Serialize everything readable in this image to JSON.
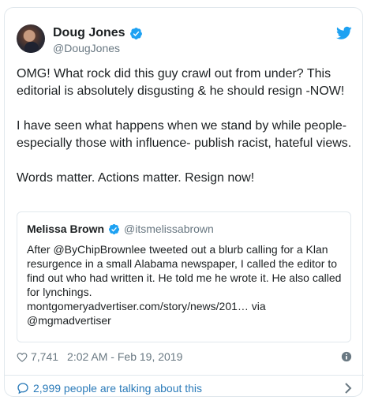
{
  "tweet": {
    "author": {
      "display_name": "Doug Jones",
      "handle": "@DougJones"
    },
    "text": "OMG! What rock did this guy crawl out from under? This editorial is absolutely disgusting & he should resign -NOW!\n\nI have seen what happens when we stand by while people- especially those with influence- publish racist, hateful views.\n\nWords matter. Actions matter. Resign now!",
    "quoted": {
      "display_name": "Melissa Brown",
      "handle": "@itsmelissabrown",
      "text": "After @ByChipBrownlee tweeted out a blurb calling for a Klan resurgence in a small Alabama newspaper, I called the editor to find out who had written it. He told me he wrote it. He also called for lynchings.\nmontgomeryadvertiser.com/story/news/201… via @mgmadvertiser"
    },
    "likes": "7,741",
    "timestamp": "2:02 AM - Feb 19, 2019",
    "talking": "2,999 people are talking about this"
  },
  "colors": {
    "twitter_blue": "#1da1f2",
    "link_blue": "#2b7bb9",
    "secondary_text": "#697882",
    "border": "#e1e8ed"
  },
  "icons": [
    "avatar",
    "verified-icon",
    "twitter-bird-icon",
    "heart-icon",
    "info-icon",
    "reply-bubble-icon",
    "chevron-right-icon"
  ]
}
